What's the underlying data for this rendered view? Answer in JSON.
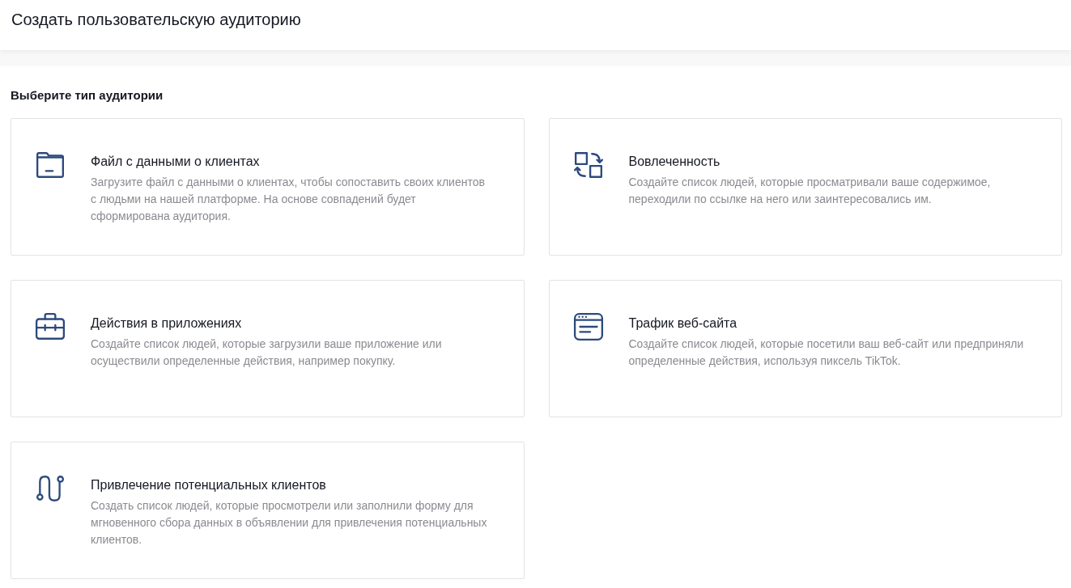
{
  "header": {
    "title": "Создать пользовательскую аудиторию"
  },
  "section": {
    "title": "Выберите тип аудитории"
  },
  "cards": [
    {
      "kind": "folder",
      "title": "Файл с данными о клиентах",
      "description": "Загрузите файл с данными о клиентах, чтобы сопоставить своих клиентов с людьми на нашей платформе. На основе совпадений будет сформирована аудитория."
    },
    {
      "kind": "swap",
      "title": "Вовлеченность",
      "description": "Создайте список людей, которые просматривали ваше содержимое, переходили по ссылке на него или заинтересовались им."
    },
    {
      "kind": "briefcase",
      "title": "Действия в приложениях",
      "description": "Создайте список людей, которые загрузили ваше приложение или осуществили определенные действия, например покупку."
    },
    {
      "kind": "browser",
      "title": "Трафик веб-сайта",
      "description": "Создайте список людей, которые посетили ваш веб-сайт или предприняли определенные действия, используя пиксель TikTok."
    },
    {
      "kind": "path",
      "title": "Привлечение потенциальных клиентов",
      "description": "Создать список людей, которые просмотрели или заполнили форму для мгновенного сбора данных в объявлении для привлечения потенциальных клиентов."
    }
  ]
}
